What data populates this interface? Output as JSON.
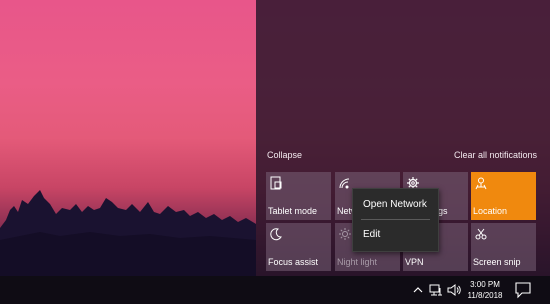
{
  "action_center": {
    "collapse_label": "Collapse",
    "clear_label": "Clear all notifications",
    "accent_color": "#f0890e",
    "tiles": [
      {
        "label": "Tablet mode",
        "icon": "tablet-mode-icon"
      },
      {
        "label": "Netw",
        "icon": "network-icon"
      },
      {
        "label": "ngs",
        "icon": "settings-icon"
      },
      {
        "label": "Location",
        "icon": "location-icon",
        "state": "active"
      },
      {
        "label": "Focus assist",
        "icon": "moon-icon"
      },
      {
        "label": "Night light",
        "icon": "brightness-icon",
        "state": "disabled"
      },
      {
        "label": "VPN",
        "icon": "vpn-icon"
      },
      {
        "label": "Screen snip",
        "icon": "screen-snip-icon"
      }
    ]
  },
  "context_menu": {
    "items": [
      "Open Network",
      "Edit"
    ]
  },
  "taskbar": {
    "time": "3:00 PM",
    "date": "11/8/2018"
  }
}
